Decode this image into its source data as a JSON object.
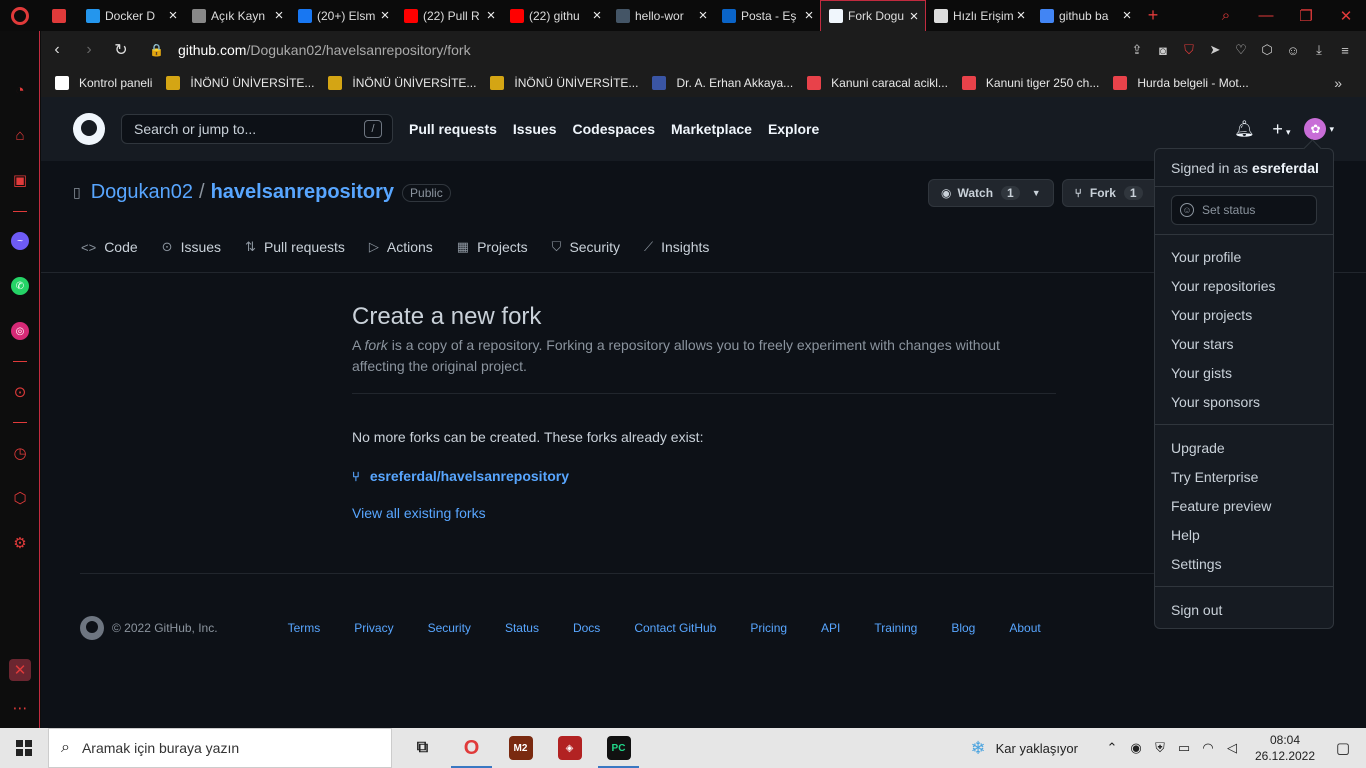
{
  "browser": {
    "tabs": [
      {
        "title": "",
        "favicon": "gamepad-icon",
        "color": "#e03a3a"
      },
      {
        "title": "Docker D",
        "favicon": "docker-icon",
        "color": "#2496ed"
      },
      {
        "title": "Açık Kayn",
        "favicon": "contact-card-icon",
        "color": "#888888"
      },
      {
        "title": "(20+) Elsm",
        "favicon": "facebook-icon",
        "color": "#1877f2"
      },
      {
        "title": "(22) Pull R",
        "favicon": "youtube-icon",
        "color": "#ff0000"
      },
      {
        "title": "(22) githu",
        "favicon": "youtube-icon",
        "color": "#ff0000"
      },
      {
        "title": "hello-wor",
        "favicon": "globe-icon",
        "color": "#445566"
      },
      {
        "title": "Posta - Eş",
        "favicon": "outlook-icon",
        "color": "#0a64c8"
      },
      {
        "title": "Fork Dogu",
        "favicon": "github-icon",
        "color": "#f0f6fc",
        "active": true
      },
      {
        "title": "Hızlı Erişim",
        "favicon": "grid-icon",
        "color": "#dddddd"
      },
      {
        "title": "github ba",
        "favicon": "google-icon",
        "color": "#4285f4"
      }
    ],
    "url_domain": "github.com",
    "url_path": "/Dogukan02/havelsanrepository/fork",
    "bookmarks": [
      {
        "label": "Kontrol paneli",
        "color": "#ffffff"
      },
      {
        "label": "İNÖNÜ ÜNİVERSİTE...",
        "color": "#d4a514"
      },
      {
        "label": "İNÖNÜ ÜNİVERSİTE...",
        "color": "#d4a514"
      },
      {
        "label": "İNÖNÜ ÜNİVERSİTE...",
        "color": "#d4a514"
      },
      {
        "label": "Dr. A. Erhan Akkaya...",
        "color": "#3a55a4"
      },
      {
        "label": "Kanuni caracal acikl...",
        "color": "#e8424a"
      },
      {
        "label": "Kanuni tiger 250 ch...",
        "color": "#e8424a"
      },
      {
        "label": "Hurda belgeli - Mot...",
        "color": "#e8424a"
      }
    ]
  },
  "github": {
    "search_placeholder": "Search or jump to...",
    "search_key": "/",
    "nav": [
      "Pull requests",
      "Issues",
      "Codespaces",
      "Marketplace",
      "Explore"
    ],
    "repo": {
      "owner": "Dogukan02",
      "name": "havelsanrepository",
      "visibility": "Public",
      "watch_label": "Watch",
      "watch_count": "1",
      "fork_label": "Fork",
      "fork_count": "1"
    },
    "repo_tabs": [
      {
        "label": "Code",
        "icon": "code-icon"
      },
      {
        "label": "Issues",
        "icon": "issue-icon"
      },
      {
        "label": "Pull requests",
        "icon": "pull-request-icon"
      },
      {
        "label": "Actions",
        "icon": "play-icon"
      },
      {
        "label": "Projects",
        "icon": "table-icon"
      },
      {
        "label": "Security",
        "icon": "shield-icon"
      },
      {
        "label": "Insights",
        "icon": "graph-icon"
      }
    ],
    "fork_page": {
      "title": "Create a new fork",
      "desc_a": "A ",
      "desc_em": "fork",
      "desc_b": " is a copy of a repository. Forking a repository allows you to freely experiment with changes without affecting the original project.",
      "no_more": "No more forks can be created. These forks already exist:",
      "existing_fork": "esreferdal/havelsanrepository",
      "view_all": "View all existing forks"
    },
    "footer": {
      "copyright": "© 2022 GitHub, Inc.",
      "links": [
        "Terms",
        "Privacy",
        "Security",
        "Status",
        "Docs",
        "Contact GitHub",
        "Pricing",
        "API",
        "Training",
        "Blog",
        "About"
      ]
    },
    "user_menu": {
      "signed_in_prefix": "Signed in as ",
      "username": "esreferdal",
      "set_status": "Set status",
      "group1": [
        "Your profile",
        "Your repositories",
        "Your projects",
        "Your stars",
        "Your gists",
        "Your sponsors"
      ],
      "group2": [
        "Upgrade",
        "Try Enterprise",
        "Feature preview",
        "Help",
        "Settings"
      ],
      "sign_out": "Sign out"
    }
  },
  "taskbar": {
    "search_placeholder": "Aramak için buraya yazın",
    "weather": "Kar yaklaşıyor",
    "time": "08:04",
    "date": "26.12.2022",
    "apps": [
      {
        "name": "task-view-icon",
        "color": "#e6e6e6"
      },
      {
        "name": "opera-icon",
        "color": "#e6e6e6",
        "open": true
      },
      {
        "name": "metin2-icon",
        "color": "#7a2a10"
      },
      {
        "name": "game-icon",
        "color": "#b22222"
      },
      {
        "name": "pycharm-icon",
        "color": "#111111",
        "open": true
      }
    ]
  }
}
